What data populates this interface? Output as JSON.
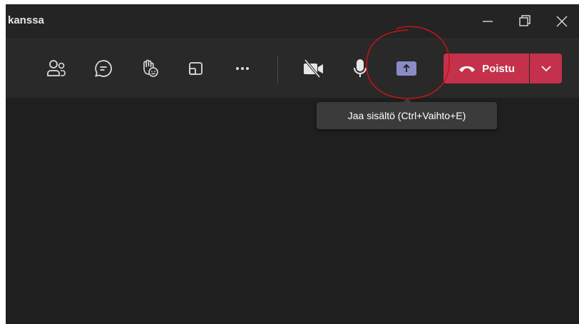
{
  "window": {
    "title": "kanssa",
    "controls": {
      "minimize": "minimize-icon",
      "maximize": "maximize-icon",
      "close": "close-icon"
    }
  },
  "toolbar": {
    "buttons": [
      {
        "name": "participants",
        "icon": "people-icon"
      },
      {
        "name": "chat",
        "icon": "chat-icon"
      },
      {
        "name": "reactions",
        "icon": "raise-hand-icon"
      },
      {
        "name": "rooms",
        "icon": "breakout-rooms-icon"
      },
      {
        "name": "more",
        "icon": "more-options-icon"
      },
      {
        "name": "camera",
        "icon": "camera-off-icon"
      },
      {
        "name": "mic",
        "icon": "microphone-icon"
      },
      {
        "name": "share",
        "icon": "share-content-icon"
      }
    ],
    "leave_label": "Poistu",
    "leave_color": "#c4314b"
  },
  "tooltip": {
    "text": "Jaa sisältö (Ctrl+Vaihto+E)"
  },
  "colors": {
    "background": "#1f1f1f",
    "toolbar": "#292929",
    "share_accent": "#8b8cc7",
    "annotation": "#c0141a"
  }
}
